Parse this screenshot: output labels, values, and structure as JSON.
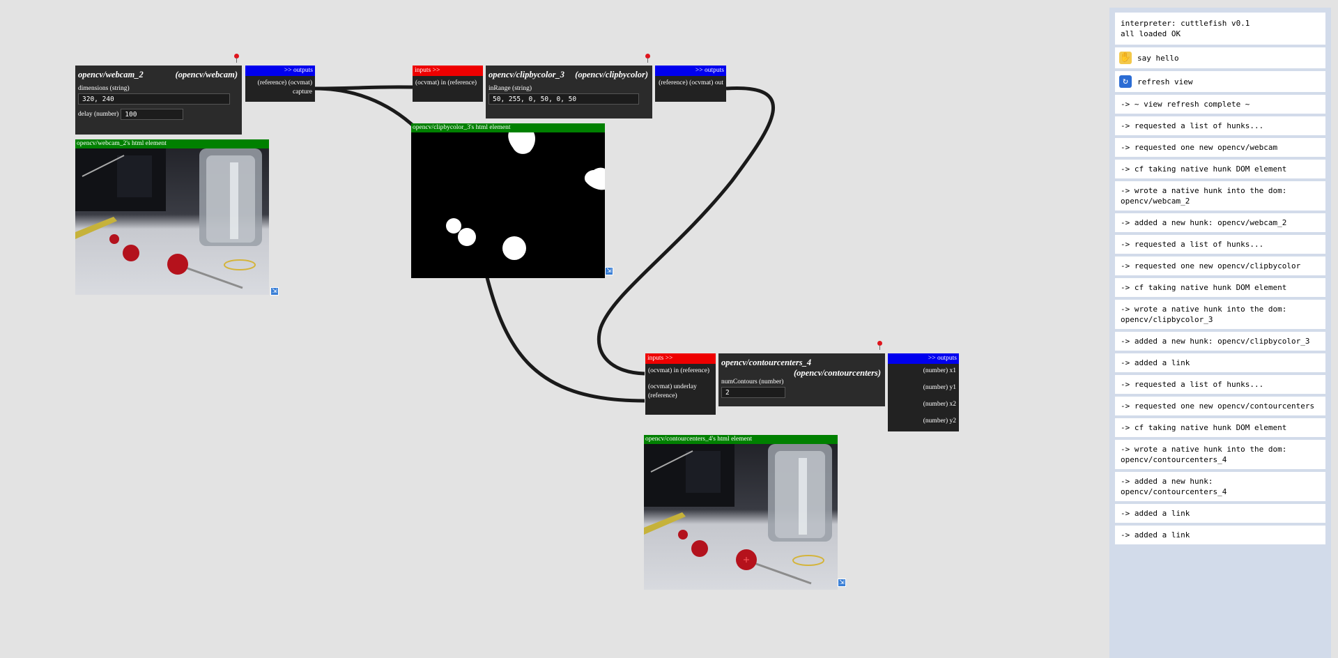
{
  "webcam_hunk": {
    "name": "opencv/webcam_2",
    "type": "(opencv/webcam)",
    "params": [
      {
        "label": "dimensions (string)",
        "value": "320, 240"
      },
      {
        "label": "delay (number)",
        "value": "100"
      }
    ],
    "outputs_header": ">> outputs",
    "outputs": [
      {
        "label": "(reference) (ocvmat) capture"
      }
    ],
    "element_label": "opencv/webcam_2's html element"
  },
  "clip_hunk": {
    "inputs_header": "inputs >>",
    "inputs": [
      {
        "label": "(ocvmat) in (reference)"
      }
    ],
    "name": "opencv/clipbycolor_3",
    "type": "(opencv/clipbycolor)",
    "params": [
      {
        "label": "inRange (string)",
        "value": "50, 255, 0, 50, 0, 50"
      }
    ],
    "outputs_header": ">> outputs",
    "outputs": [
      {
        "label": "(reference) (ocvmat) out"
      }
    ],
    "element_label": "opencv/clipbycolor_3's html element"
  },
  "contour_hunk": {
    "inputs_header": "inputs >>",
    "inputs": [
      {
        "label": "(ocvmat) in (reference)"
      },
      {
        "label": "(ocvmat) underlay (reference)"
      }
    ],
    "name": "opencv/contourcenters_4",
    "type": "(opencv/contourcenters)",
    "params": [
      {
        "label": "numContours (number)",
        "value": "2"
      }
    ],
    "outputs_header": ">> outputs",
    "outputs": [
      {
        "label": "(number) x1"
      },
      {
        "label": "(number) y1"
      },
      {
        "label": "(number) x2"
      },
      {
        "label": "(number) y2"
      }
    ],
    "element_label": "opencv/contourcenters_4's html element"
  },
  "console": {
    "header": "interpreter: cuttlefish v0.1\nall loaded OK",
    "say_hello": "say hello",
    "refresh_view": "refresh view",
    "log": [
      "-> ~ view refresh complete ~",
      "-> requested a list of hunks...",
      "-> requested one new opencv/webcam",
      "-> cf taking native hunk DOM element",
      "-> wrote a native hunk into the dom: opencv/webcam_2",
      "-> added a new hunk: opencv/webcam_2",
      "-> requested a list of hunks...",
      "-> requested one new opencv/clipbycolor",
      "-> cf taking native hunk DOM element",
      "-> wrote a native hunk into the dom: opencv/clipbycolor_3",
      "-> added a new hunk: opencv/clipbycolor_3",
      "-> added a link",
      "-> requested a list of hunks...",
      "-> requested one new opencv/contourcenters",
      "-> cf taking native hunk DOM element",
      "-> wrote a native hunk into the dom: opencv/contourcenters_4",
      "-> added a new hunk: opencv/contourcenters_4",
      "-> added a link",
      "-> added a link"
    ]
  },
  "colors": {
    "canvas": "#e3e3e3",
    "hunk": "#2b2b2b",
    "inputs_header": "#ee0000",
    "outputs_header": "#0000ee",
    "element_bar": "#008000",
    "console_bg": "#d2dbea"
  },
  "icons": [
    "pin-icon",
    "resize-icon",
    "wave-hand-icon",
    "refresh-icon"
  ]
}
